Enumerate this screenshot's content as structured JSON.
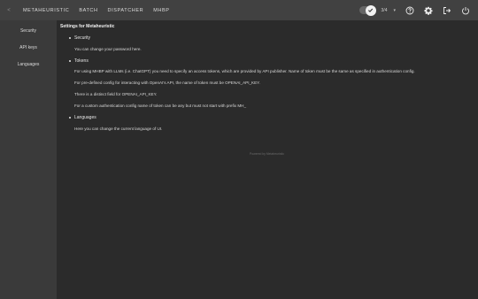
{
  "nav": {
    "back_icon": "back-arrow-icon",
    "items": [
      "METAHEURISTIC",
      "BATCH",
      "DISPATCHER",
      "MHBP"
    ]
  },
  "toolbar": {
    "zoom_label": "3/4",
    "caret": "▾",
    "icons": [
      "help-icon",
      "gear-icon",
      "logout-icon",
      "power-icon"
    ]
  },
  "sidebar": {
    "items": [
      "Security",
      "API keys",
      "Languages"
    ]
  },
  "main": {
    "title": "Settings for Metaheuristic",
    "sections": [
      {
        "heading": "Security",
        "lines": [
          "You can change your password here."
        ]
      },
      {
        "heading": "Tokens",
        "lines": [
          "For using MHBP with LLMs (i.e. ChatGPT) you need to specify an access tokens, which are provided by API publisher. Name of token must be the same as specified in authentication config.",
          "For pre-defined config for interacting with OpenAI's API, the name of token must be OPENAI_API_KEY.",
          "There is a distinct field for OPENAI_API_KEY.",
          "For a custom authentication config name of token can be any but must not start with prefix MH_"
        ]
      },
      {
        "heading": "Languages",
        "lines": [
          "Here you can change the current language of UI."
        ]
      }
    ],
    "footer": "Powered by Metaheuristic"
  },
  "colors": {
    "topbar": "#414141",
    "sidebar": "#3a3a3a",
    "main": "#2b2b2b"
  }
}
